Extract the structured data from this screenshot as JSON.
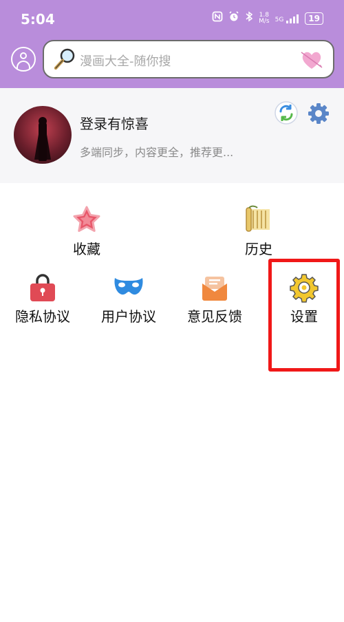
{
  "status_bar": {
    "time": "5:04",
    "icons": [
      "nfc-icon",
      "alarm-icon",
      "bluetooth-icon",
      "network-speed-icon",
      "signal-icon",
      "battery-icon"
    ],
    "speed_value": "1.8",
    "speed_unit": "M/s",
    "network_type": "5G",
    "battery": "19"
  },
  "header": {
    "search_placeholder": "漫画大全-随你搜",
    "accent_color": "#b98ddb"
  },
  "profile": {
    "title": "登录有惊喜",
    "subtitle": "多端同步，内容更全，推荐更..."
  },
  "menu_row1": [
    {
      "label": "收藏",
      "icon": "star-icon"
    },
    {
      "label": "历史",
      "icon": "scroll-icon"
    }
  ],
  "menu_row2": [
    {
      "label": "隐私协议",
      "icon": "lock-icon"
    },
    {
      "label": "用户协议",
      "icon": "mask-icon"
    },
    {
      "label": "意见反馈",
      "icon": "mail-icon"
    },
    {
      "label": "设置",
      "icon": "settings-gear-icon"
    }
  ],
  "highlight_color": "#f01818"
}
